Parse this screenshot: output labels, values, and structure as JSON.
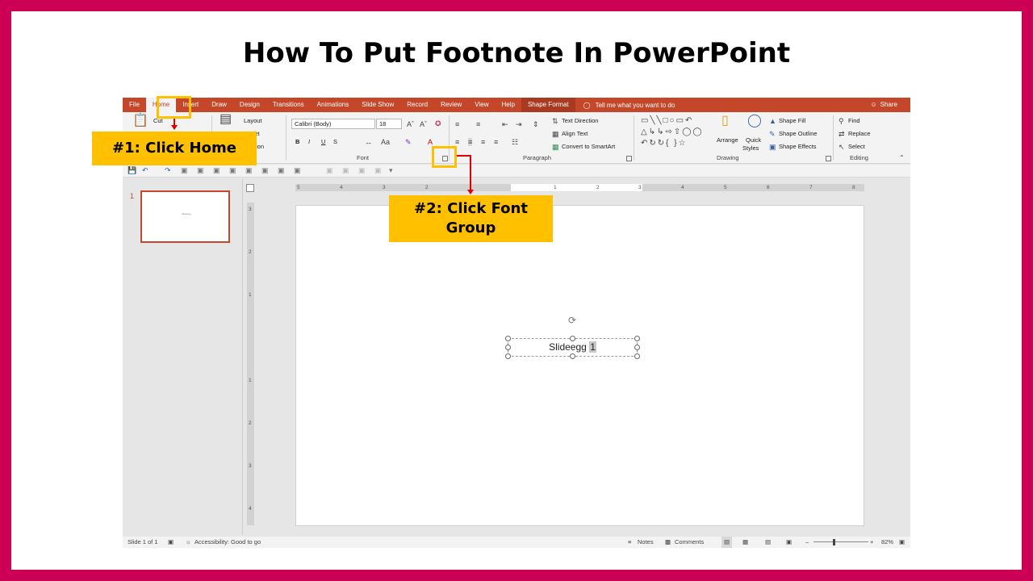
{
  "page_title": "How To Put Footnote In PowerPoint",
  "tabs": [
    "File",
    "Home",
    "Insert",
    "Draw",
    "Design",
    "Transitions",
    "Animations",
    "Slide Show",
    "Record",
    "Review",
    "View",
    "Help",
    "Shape Format"
  ],
  "tell_me": "Tell me what you want to do",
  "share": "Share",
  "ribbon": {
    "clipboard": {
      "cut": "Cut"
    },
    "slides": {
      "layout": "Layout",
      "reset": "Reset",
      "section": "Section"
    },
    "font": {
      "font_name": "Calibri (Body)",
      "font_size": "18",
      "bold": "B",
      "italic": "I",
      "underline": "U",
      "strike": "S",
      "label": "Font"
    },
    "paragraph": {
      "text_direction": "Text Direction",
      "align_text": "Align Text",
      "convert_smartart": "Convert to SmartArt",
      "label": "Paragraph"
    },
    "drawing": {
      "arrange": "Arrange",
      "quick_styles_1": "Quick",
      "quick_styles_2": "Styles",
      "shape_fill": "Shape Fill",
      "shape_outline": "Shape Outline",
      "shape_effects": "Shape Effects",
      "label": "Drawing"
    },
    "editing": {
      "find": "Find",
      "replace": "Replace",
      "select": "Select",
      "label": "Editing"
    }
  },
  "slides_pane": {
    "slide_number": "1",
    "thumb_text": "Slideegg"
  },
  "ruler": {
    "h_labels": [
      "5",
      "4",
      "3",
      "2",
      "1",
      "2",
      "3",
      "4",
      "5",
      "6",
      "7",
      "8"
    ],
    "v_labels": [
      "3",
      "2",
      "1",
      "1",
      "2",
      "3",
      "4"
    ]
  },
  "slide": {
    "text": "Slideegg",
    "footnote_marker": "1"
  },
  "status": {
    "slide_info": "Slide 1 of 1",
    "accessibility": "Accessibility: Good to go",
    "notes": "Notes",
    "comments": "Comments",
    "zoom": "82%"
  },
  "callouts": {
    "step1": "#1: Click Home",
    "step2_line1": "#2: Click Font",
    "step2_line2": "Group"
  },
  "colors": {
    "accent": "#c4472a",
    "frame": "#cc0055",
    "callout": "#ffc000",
    "arrow": "#e00000"
  }
}
